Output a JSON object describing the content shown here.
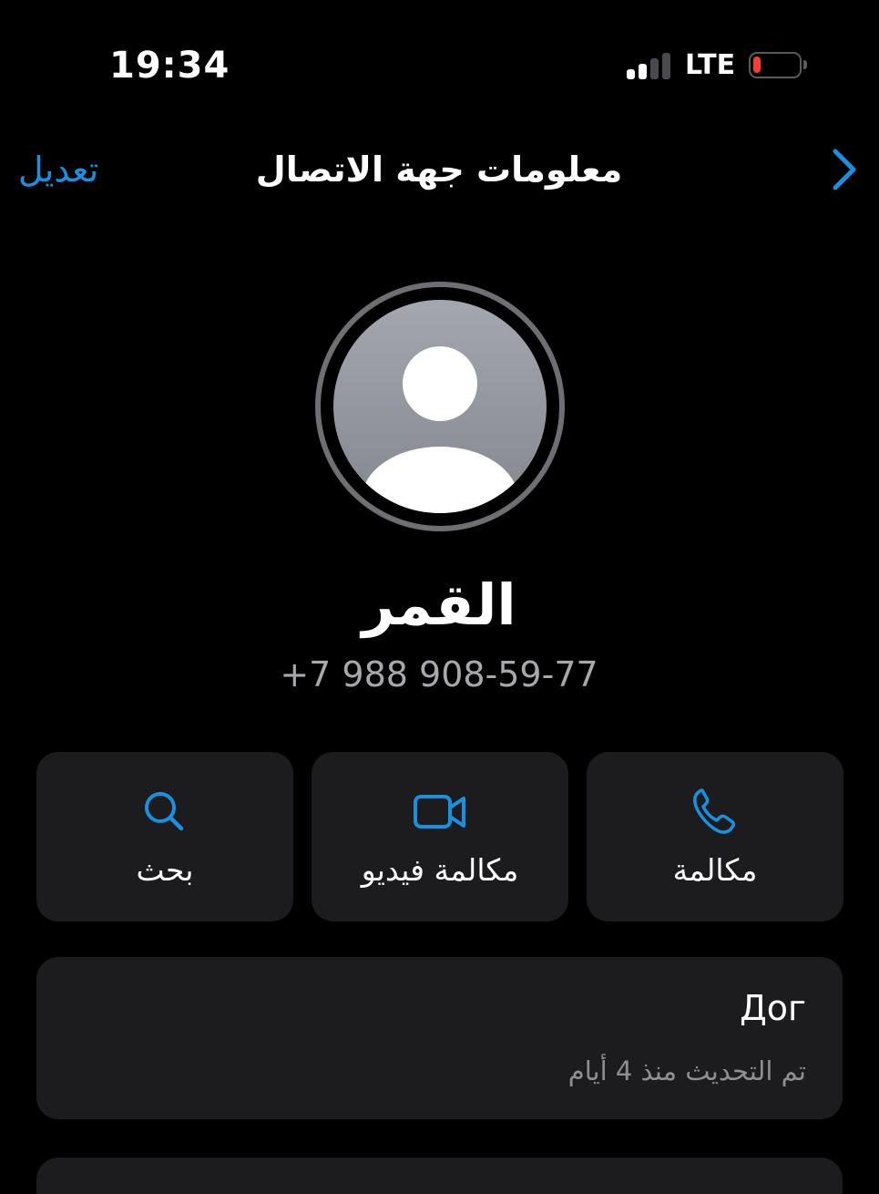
{
  "colors": {
    "background": "#000000",
    "card": "#1c1c1e",
    "accent": "#1a90e0",
    "text": "#ffffff",
    "secondary_text": "#8e8e93",
    "phone_text": "#a7a7ac",
    "battery_low": "#ff3b30",
    "signal_inactive": "#4a4a4e",
    "avatar_ring": "#6e6e73"
  },
  "status_bar": {
    "time": "19:34",
    "network": "LTE",
    "signal_bars_active": 2,
    "signal_bars_total": 4,
    "battery_level": 0.1
  },
  "nav": {
    "edit_label": "تعديل",
    "title": "معلومات جهة الاتصال",
    "back_icon": "chevron-right-icon"
  },
  "contact": {
    "avatar_icon": "person-silhouette-icon",
    "name": "القمر",
    "phone": "+7 988 908-59-77"
  },
  "actions": [
    {
      "label": "بحث",
      "icon": "search-icon"
    },
    {
      "label": "مكالمة فيديو",
      "icon": "video-camera-icon"
    },
    {
      "label": "مكالمة",
      "icon": "phone-icon"
    }
  ],
  "info_card": {
    "title": "Дог",
    "subtitle": "تم التحديث منذ 4 أيام"
  }
}
